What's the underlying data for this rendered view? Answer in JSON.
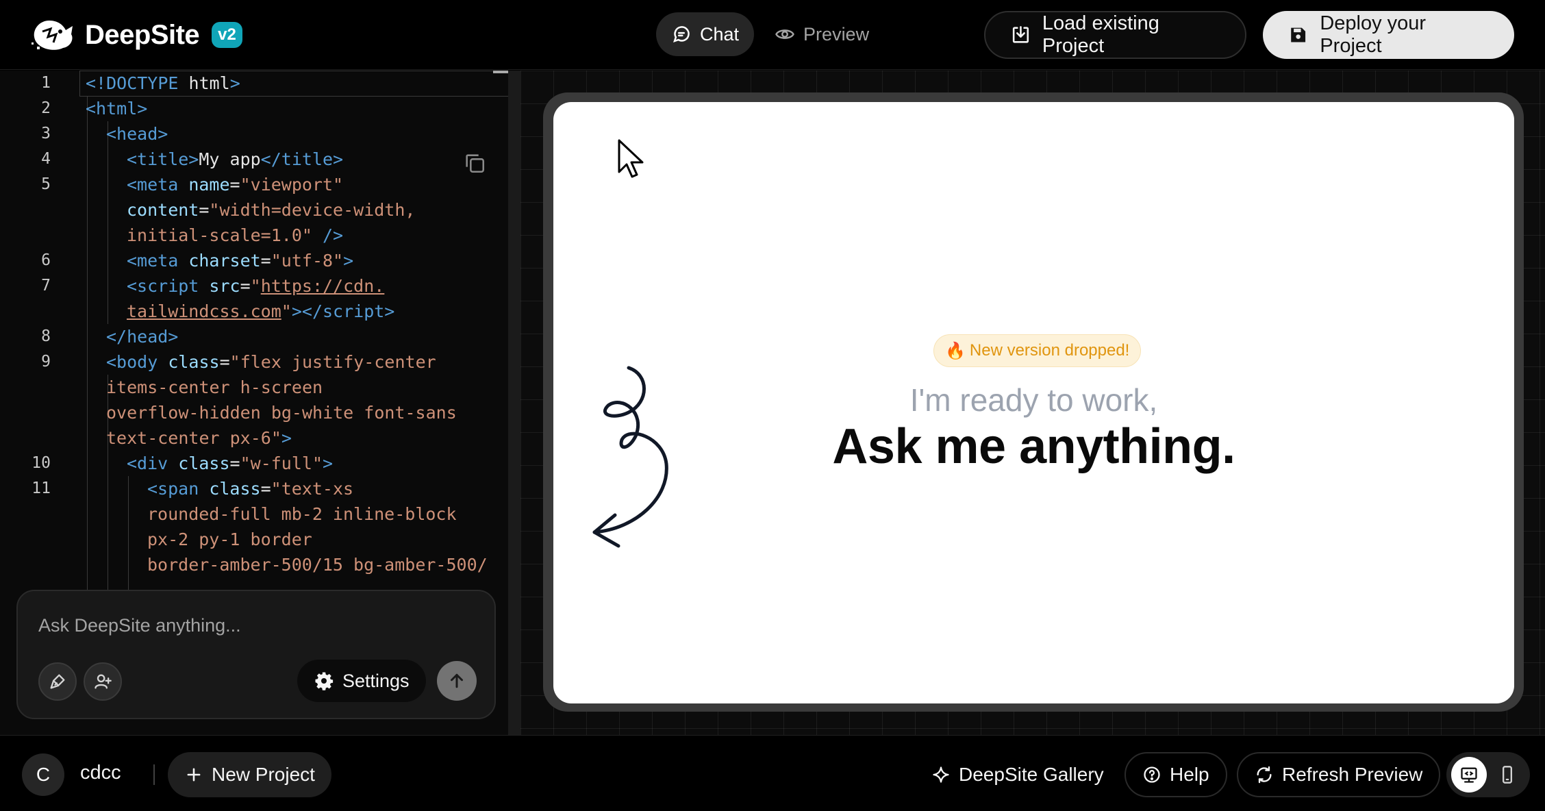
{
  "header": {
    "brand_name": "DeepSite",
    "version_badge": "v2",
    "tabs": [
      {
        "label": "Chat",
        "icon": "chat-icon",
        "active": true
      },
      {
        "label": "Preview",
        "icon": "eye-icon",
        "active": false
      }
    ],
    "load_label": "Load existing Project",
    "deploy_label": "Deploy your Project"
  },
  "editor": {
    "line_numbers": [
      "1",
      "2",
      "3",
      "4",
      "5",
      "6",
      "7",
      "8",
      "9",
      "10",
      "11"
    ]
  },
  "chat": {
    "placeholder": "Ask DeepSite anything...",
    "settings_label": "Settings"
  },
  "preview": {
    "badge_icon": "🔥",
    "badge_text": "New version dropped!",
    "subtitle": "I'm ready to work,",
    "title": "Ask me anything."
  },
  "footer": {
    "avatar_initial": "C",
    "username": "cdcc",
    "new_project_label": "New Project",
    "gallery_label": "DeepSite Gallery",
    "help_label": "Help",
    "refresh_label": "Refresh Preview"
  },
  "colors": {
    "accent_badge": "#10a5b8",
    "amber": "#e0950f",
    "background": "#000000"
  }
}
